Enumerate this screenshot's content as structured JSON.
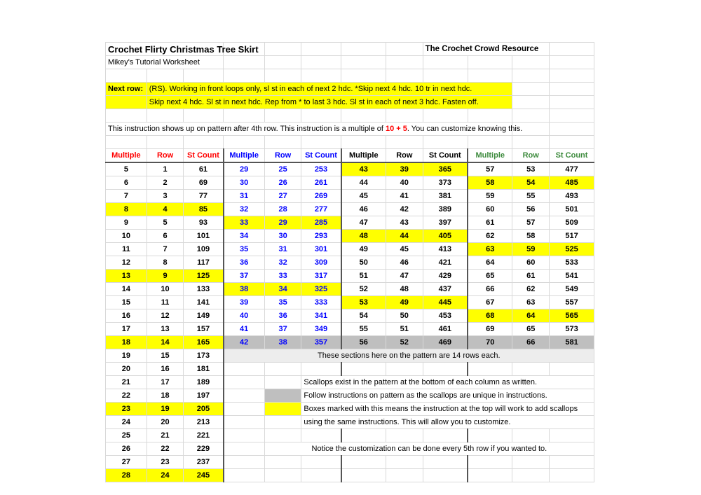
{
  "header": {
    "title": "Crochet Flirty Christmas Tree Skirt",
    "subtitle": "Mikey's Tutorial Worksheet",
    "brand": "The Crochet Crowd Resource"
  },
  "instructions": {
    "label": "Next row:",
    "line1": "(RS). Working in front loops only, sl st in each of next 2 hdc. *Skip next 4 hdc. 10 tr in next hdc.",
    "line2": "Skip next 4 hdc. Sl st in next hdc. Rep from * to last 3 hdc. Sl st in each of next 3 hdc. Fasten off.",
    "note_pre": "This instruction shows up on pattern after 4th row. This instruction is a multiple of ",
    "note_highlight": "10 + 5",
    "note_post": ". You can customize knowing this."
  },
  "columns": {
    "multiple": "Multiple",
    "row": "Row",
    "st_count": "St Count"
  },
  "notes": {
    "n1": "These sections here on the pattern are 14 rows each.",
    "n2": "Scallops exist in the pattern at the bottom of each column as written.",
    "n3": "Follow instructions on pattern as the scallops are unique in instructions.",
    "n4": "Boxes marked with this means the instruction at the top will work to add scallops",
    "n5": "using the same instructions. This will allow you to customize.",
    "n6": "Notice the customization can be done every 5th row if you wanted to."
  },
  "colors": {
    "group1_header": "#ff0000",
    "group2_header": "#0000ff",
    "group3_header": "#000000",
    "group4_header": "#3c8a3c",
    "highlight": "#ffff00",
    "gray": "#bfbfbf",
    "light_gray": "#ededed"
  },
  "chart_data": {
    "type": "table",
    "title": "Crochet Flirty Christmas Tree Skirt - Multiple / Row / St Count",
    "groups": [
      {
        "name": "group1",
        "header_color": "#ff0000",
        "text_color": "#000000",
        "columns": [
          "Multiple",
          "Row",
          "St Count"
        ],
        "rows": [
          {
            "multiple": 5,
            "row": 1,
            "st": 61,
            "fill": "none"
          },
          {
            "multiple": 6,
            "row": 2,
            "st": 69,
            "fill": "none"
          },
          {
            "multiple": 7,
            "row": 3,
            "st": 77,
            "fill": "none"
          },
          {
            "multiple": 8,
            "row": 4,
            "st": 85,
            "fill": "yellow"
          },
          {
            "multiple": 9,
            "row": 5,
            "st": 93,
            "fill": "none"
          },
          {
            "multiple": 10,
            "row": 6,
            "st": 101,
            "fill": "none"
          },
          {
            "multiple": 11,
            "row": 7,
            "st": 109,
            "fill": "none"
          },
          {
            "multiple": 12,
            "row": 8,
            "st": 117,
            "fill": "none"
          },
          {
            "multiple": 13,
            "row": 9,
            "st": 125,
            "fill": "yellow"
          },
          {
            "multiple": 14,
            "row": 10,
            "st": 133,
            "fill": "none"
          },
          {
            "multiple": 15,
            "row": 11,
            "st": 141,
            "fill": "none"
          },
          {
            "multiple": 16,
            "row": 12,
            "st": 149,
            "fill": "none"
          },
          {
            "multiple": 17,
            "row": 13,
            "st": 157,
            "fill": "none"
          },
          {
            "multiple": 18,
            "row": 14,
            "st": 165,
            "fill": "yellow"
          },
          {
            "multiple": 19,
            "row": 15,
            "st": 173,
            "fill": "none"
          },
          {
            "multiple": 20,
            "row": 16,
            "st": 181,
            "fill": "none"
          },
          {
            "multiple": 21,
            "row": 17,
            "st": 189,
            "fill": "none"
          },
          {
            "multiple": 22,
            "row": 18,
            "st": 197,
            "fill": "none"
          },
          {
            "multiple": 23,
            "row": 19,
            "st": 205,
            "fill": "yellow"
          },
          {
            "multiple": 24,
            "row": 20,
            "st": 213,
            "fill": "none"
          },
          {
            "multiple": 25,
            "row": 21,
            "st": 221,
            "fill": "none"
          },
          {
            "multiple": 26,
            "row": 22,
            "st": 229,
            "fill": "none"
          },
          {
            "multiple": 27,
            "row": 23,
            "st": 237,
            "fill": "none"
          },
          {
            "multiple": 28,
            "row": 24,
            "st": 245,
            "fill": "yellow"
          }
        ]
      },
      {
        "name": "group2",
        "header_color": "#0000ff",
        "text_color": "#0000ff",
        "columns": [
          "Multiple",
          "Row",
          "St Count"
        ],
        "rows": [
          {
            "multiple": 29,
            "row": 25,
            "st": 253,
            "fill": "none"
          },
          {
            "multiple": 30,
            "row": 26,
            "st": 261,
            "fill": "none"
          },
          {
            "multiple": 31,
            "row": 27,
            "st": 269,
            "fill": "none"
          },
          {
            "multiple": 32,
            "row": 28,
            "st": 277,
            "fill": "none"
          },
          {
            "multiple": 33,
            "row": 29,
            "st": 285,
            "fill": "yellow"
          },
          {
            "multiple": 34,
            "row": 30,
            "st": 293,
            "fill": "none"
          },
          {
            "multiple": 35,
            "row": 31,
            "st": 301,
            "fill": "none"
          },
          {
            "multiple": 36,
            "row": 32,
            "st": 309,
            "fill": "none"
          },
          {
            "multiple": 37,
            "row": 33,
            "st": 317,
            "fill": "none"
          },
          {
            "multiple": 38,
            "row": 34,
            "st": 325,
            "fill": "yellow"
          },
          {
            "multiple": 39,
            "row": 35,
            "st": 333,
            "fill": "none"
          },
          {
            "multiple": 40,
            "row": 36,
            "st": 341,
            "fill": "none"
          },
          {
            "multiple": 41,
            "row": 37,
            "st": 349,
            "fill": "none"
          },
          {
            "multiple": 42,
            "row": 38,
            "st": 357,
            "fill": "gray"
          }
        ]
      },
      {
        "name": "group3",
        "header_color": "#000000",
        "text_color": "#000000",
        "columns": [
          "Multiple",
          "Row",
          "St Count"
        ],
        "rows": [
          {
            "multiple": 43,
            "row": 39,
            "st": 365,
            "fill": "yellow"
          },
          {
            "multiple": 44,
            "row": 40,
            "st": 373,
            "fill": "none"
          },
          {
            "multiple": 45,
            "row": 41,
            "st": 381,
            "fill": "none"
          },
          {
            "multiple": 46,
            "row": 42,
            "st": 389,
            "fill": "none"
          },
          {
            "multiple": 47,
            "row": 43,
            "st": 397,
            "fill": "none"
          },
          {
            "multiple": 48,
            "row": 44,
            "st": 405,
            "fill": "yellow"
          },
          {
            "multiple": 49,
            "row": 45,
            "st": 413,
            "fill": "none"
          },
          {
            "multiple": 50,
            "row": 46,
            "st": 421,
            "fill": "none"
          },
          {
            "multiple": 51,
            "row": 47,
            "st": 429,
            "fill": "none"
          },
          {
            "multiple": 52,
            "row": 48,
            "st": 437,
            "fill": "none"
          },
          {
            "multiple": 53,
            "row": 49,
            "st": 445,
            "fill": "yellow"
          },
          {
            "multiple": 54,
            "row": 50,
            "st": 453,
            "fill": "none"
          },
          {
            "multiple": 55,
            "row": 51,
            "st": 461,
            "fill": "none"
          },
          {
            "multiple": 56,
            "row": 52,
            "st": 469,
            "fill": "gray"
          }
        ]
      },
      {
        "name": "group4",
        "header_color": "#3c8a3c",
        "text_color": "#000000",
        "columns": [
          "Multiple",
          "Row",
          "St Count"
        ],
        "rows": [
          {
            "multiple": 57,
            "row": 53,
            "st": 477,
            "fill": "none"
          },
          {
            "multiple": 58,
            "row": 54,
            "st": 485,
            "fill": "yellow"
          },
          {
            "multiple": 59,
            "row": 55,
            "st": 493,
            "fill": "none"
          },
          {
            "multiple": 60,
            "row": 56,
            "st": 501,
            "fill": "none"
          },
          {
            "multiple": 61,
            "row": 57,
            "st": 509,
            "fill": "none"
          },
          {
            "multiple": 62,
            "row": 58,
            "st": 517,
            "fill": "none"
          },
          {
            "multiple": 63,
            "row": 59,
            "st": 525,
            "fill": "yellow"
          },
          {
            "multiple": 64,
            "row": 60,
            "st": 533,
            "fill": "none"
          },
          {
            "multiple": 65,
            "row": 61,
            "st": 541,
            "fill": "none"
          },
          {
            "multiple": 66,
            "row": 62,
            "st": 549,
            "fill": "none"
          },
          {
            "multiple": 67,
            "row": 63,
            "st": 557,
            "fill": "none"
          },
          {
            "multiple": 68,
            "row": 64,
            "st": 565,
            "fill": "yellow"
          },
          {
            "multiple": 69,
            "row": 65,
            "st": 573,
            "fill": "none"
          },
          {
            "multiple": 70,
            "row": 66,
            "st": 581,
            "fill": "gray"
          }
        ]
      }
    ]
  }
}
